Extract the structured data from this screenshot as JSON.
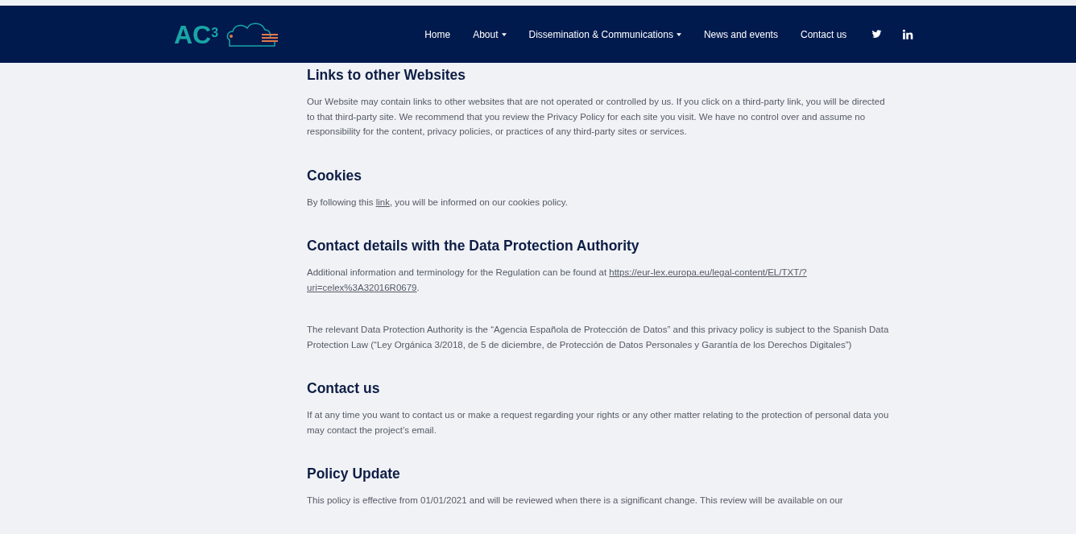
{
  "header": {
    "logo": {
      "letters": "AC",
      "superscript": "3"
    },
    "nav": [
      {
        "label": "Home",
        "dropdown": false
      },
      {
        "label": "About",
        "dropdown": true
      },
      {
        "label": "Dissemination & Communications",
        "dropdown": true
      },
      {
        "label": "News and events",
        "dropdown": false
      },
      {
        "label": "Contact us",
        "dropdown": false
      }
    ],
    "social": [
      {
        "kind": "twitter"
      },
      {
        "kind": "linkedin"
      }
    ]
  },
  "sections": [
    {
      "heading": "Links to other Websites",
      "paragraphs": [
        [
          {
            "kind": "text",
            "text": "Our Website may contain links to other websites that are not operated or controlled by us. If you click on a third-party link, you will be directed to that third-party site. We recommend that you review the Privacy Policy for each site you visit. We have no control over and assume no responsibility for the content, privacy policies, or practices of any third-party sites or services."
          }
        ]
      ]
    },
    {
      "heading": "Cookies",
      "paragraphs": [
        [
          {
            "kind": "text",
            "text": "By following this "
          },
          {
            "kind": "link",
            "text": "link"
          },
          {
            "kind": "text",
            "text": ", you will be informed on our cookies policy."
          }
        ]
      ]
    },
    {
      "heading": "Contact details with the Data Protection Authority",
      "paragraphs": [
        [
          {
            "kind": "text",
            "text": "Additional information and terminology for the Regulation can be found at "
          },
          {
            "kind": "link",
            "text": "https://eur-lex.europa.eu/legal-content/EL/TXT/?"
          },
          {
            "kind": "link",
            "text": "uri=celex%3A32016R0679"
          },
          {
            "kind": "text",
            "text": "."
          }
        ],
        [
          {
            "kind": "text",
            "text": "The relevant Data Protection Authority is the “Agencia Española de Protección de Datos” and this privacy policy is subject to the Spanish Data Protection Law (“Ley Orgánica 3/2018, de 5 de diciembre, de Protección de Datos Personales y Garantía de los Derechos Digitales”)"
          }
        ]
      ]
    },
    {
      "heading": "Contact us",
      "paragraphs": [
        [
          {
            "kind": "text",
            "text": "If at any time you want to contact us or make a request regarding your rights or any other matter relating to the protection of personal data you may contact the project’s email."
          }
        ]
      ]
    },
    {
      "heading": "Policy Update",
      "paragraphs": [
        [
          {
            "kind": "text",
            "text": "This policy is effective from 01/01/2021 and will be reviewed when there is a significant change. This review will be available on our"
          }
        ]
      ]
    }
  ]
}
